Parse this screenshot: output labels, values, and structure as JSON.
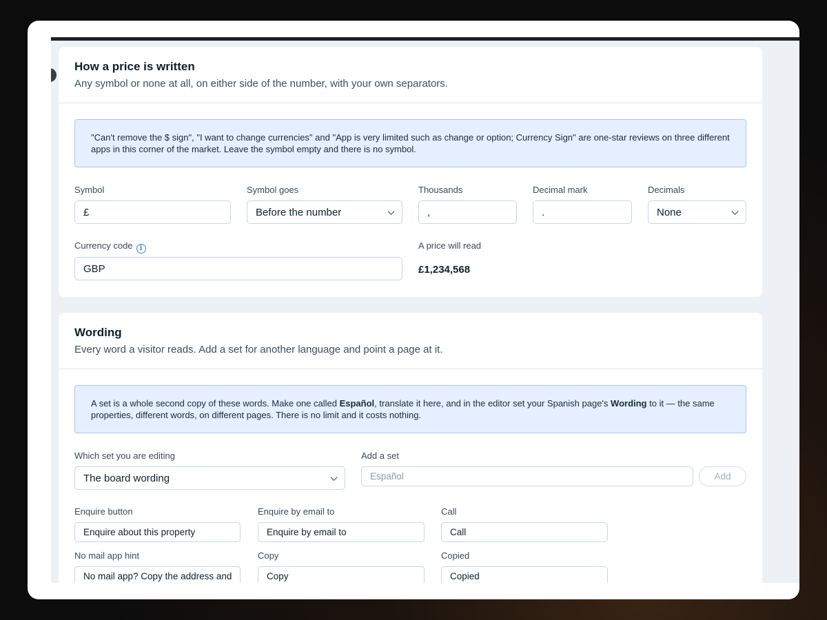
{
  "price_section": {
    "title": "How a price is written",
    "subtitle": "Any symbol or none at all, on either side of the number, with your own separators.",
    "notice": "\"Can't remove the $ sign\", \"I want to change currencies\" and \"App is very limited such as change or option; Currency Sign\" are one-star reviews on three different apps in this corner of the market. Leave the symbol empty and there is no symbol.",
    "symbol": {
      "label": "Symbol",
      "value": "£"
    },
    "symbol_goes": {
      "label": "Symbol goes",
      "value": "Before the number"
    },
    "thousands": {
      "label": "Thousands",
      "value": ","
    },
    "decimal_mark": {
      "label": "Decimal mark",
      "value": "."
    },
    "decimals": {
      "label": "Decimals",
      "value": "None"
    },
    "currency_code": {
      "label": "Currency code",
      "value": "GBP",
      "icon": "info-icon"
    },
    "preview": {
      "label": "A price will read",
      "value": "£1,234,568"
    }
  },
  "wording_section": {
    "title": "Wording",
    "subtitle": "Every word a visitor reads. Add a set for another language and point a page at it.",
    "notice": {
      "part1": "A set is a whole second copy of these words. Make one called ",
      "bold1": "Español",
      "part2": ", translate it here, and in the editor set your Spanish page's ",
      "bold2": "Wording",
      "part3": " to it — the same properties, different words, on different pages. There is no limit and it costs nothing."
    },
    "editing_set": {
      "label": "Which set you are editing",
      "value": "The board wording"
    },
    "add_set": {
      "label": "Add a set",
      "placeholder": "Español",
      "button": "Add"
    },
    "fields": [
      {
        "label": "Enquire button",
        "value": "Enquire about this property"
      },
      {
        "label": "Enquire by email to",
        "value": "Enquire by email to"
      },
      {
        "label": "Call",
        "value": "Call"
      },
      {
        "label": "No mail app hint",
        "value": "No mail app? Copy the address and"
      },
      {
        "label": "Copy",
        "value": "Copy"
      },
      {
        "label": "Copied",
        "value": "Copied"
      }
    ]
  }
}
